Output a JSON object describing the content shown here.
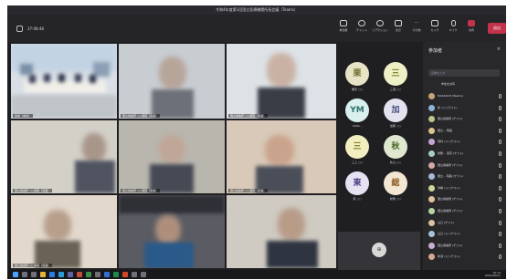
{
  "window": {
    "title": "令和4年度第1回国立医療機関所長会議（Teams）"
  },
  "toolbar": {
    "time": "37:08:48",
    "buttons": [
      {
        "label": "参加者",
        "icon": "people-icon"
      },
      {
        "label": "チャット",
        "icon": "chat-icon"
      },
      {
        "label": "リアクション",
        "icon": "reaction-icon"
      },
      {
        "label": "表示",
        "icon": "view-icon"
      },
      {
        "label": "その他",
        "icon": "more-icon"
      },
      {
        "label": "カメラ",
        "icon": "camera-icon"
      },
      {
        "label": "マイク",
        "icon": "mic-icon"
      },
      {
        "label": "共有",
        "icon": "share-icon"
      }
    ],
    "leave_label": "退出"
  },
  "tiles": [
    {
      "tag": "会場（本省）"
    },
    {
      "tag": "国立療養所 ○○病院（院長）"
    },
    {
      "tag": "国立療養所 ○○病院（院長）"
    },
    {
      "tag": "国立療養所 ○○病院（院長）"
    },
    {
      "tag": "国立療養所 ○○病院（院長）"
    },
    {
      "tag": "国立療養所 ○○病院（院長）"
    },
    {
      "tag": "国立療養所 ○○病院（院長）"
    },
    {
      "tag": ""
    },
    {
      "tag": ""
    }
  ],
  "avatars": [
    {
      "initial": "栗",
      "name": "栗原 ○○"
    },
    {
      "initial": "三",
      "name": "三浦 ○○"
    },
    {
      "initial": "YM",
      "name": "YAMA..."
    },
    {
      "initial": "加",
      "name": "加藤 ○○"
    },
    {
      "initial": "三",
      "name": "三上 ○○"
    },
    {
      "initial": "秋",
      "name": "秋山 ○○"
    },
    {
      "initial": "東",
      "name": "東 ○○"
    },
    {
      "initial": "総",
      "name": "総務 ○○"
    }
  ],
  "avatar_overflow": "⊕",
  "panel": {
    "title": "参加者",
    "close": "×",
    "search_placeholder": "名前を入力",
    "share_label": "参加を共有",
    "participants": [
      {
        "name": "MASAKI.M (Teams)"
      },
      {
        "name": "新 ○○ (ゲスト)"
      },
      {
        "name": "国立療養所 (ゲスト)"
      },
      {
        "name": "国立... 院長"
      },
      {
        "name": "東村 ○○ (ゲスト)"
      },
      {
        "name": "総務... 東京 (ゲスト)"
      },
      {
        "name": "国立療養所 (ゲスト)"
      },
      {
        "name": "国立... 院長 (ゲスト)"
      },
      {
        "name": "沖縄 ○○ (ゲスト)"
      },
      {
        "name": "国立療養所 (ゲスト)"
      },
      {
        "name": "国立療養所 (ゲスト)"
      },
      {
        "name": "山口 (ゲスト)"
      },
      {
        "name": "山口 ○○ (ゲスト)"
      },
      {
        "name": "国立療養所 (ゲスト)"
      },
      {
        "name": "新潟 ○○ (ゲスト)"
      }
    ]
  },
  "taskbar": {
    "time": "10:14",
    "date": "2022/06/01"
  }
}
